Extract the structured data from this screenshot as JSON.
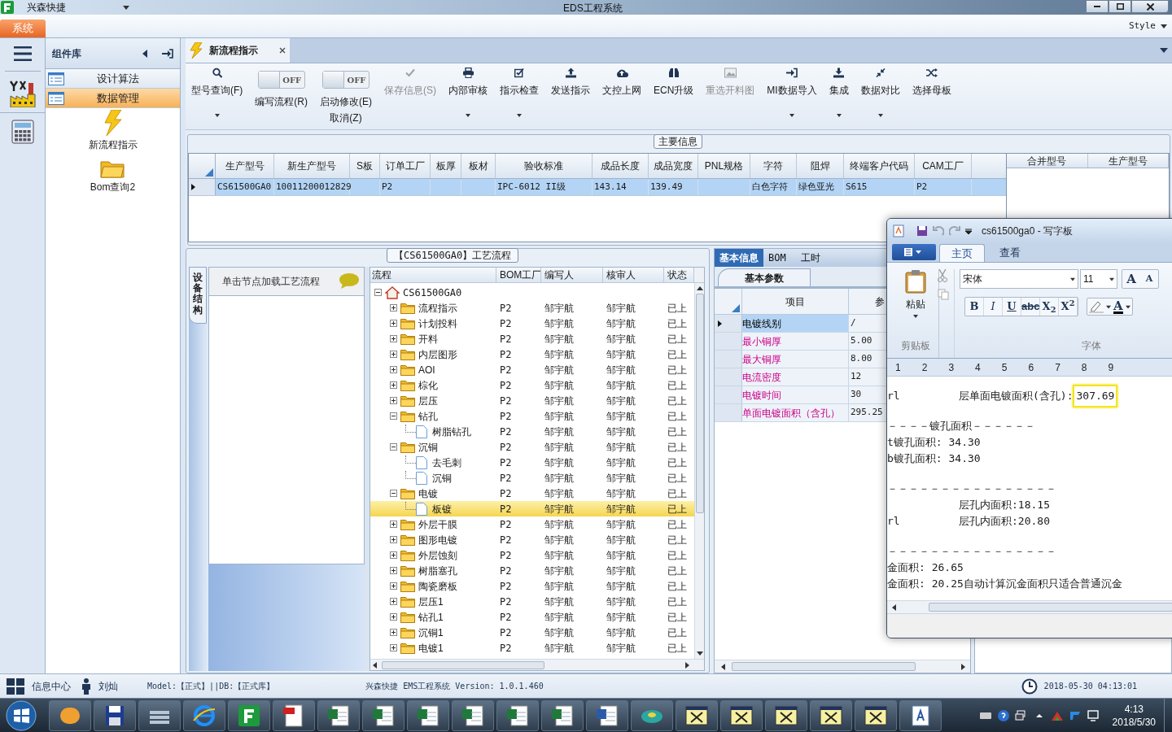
{
  "title_bar": {
    "app_name": "兴森快捷",
    "title": "EDS工程系统"
  },
  "menu_bar": {
    "tabs": [
      {
        "label": "系统",
        "selected": true
      }
    ],
    "style_label": "Style"
  },
  "sidebar": {
    "title": "组件库",
    "items": [
      {
        "label": "设计算法",
        "selected": false
      },
      {
        "label": "数据管理",
        "selected": true
      }
    ],
    "shortcuts": [
      {
        "label": "新流程指示",
        "kind": "lightning"
      },
      {
        "label": "Bom查询2",
        "kind": "folder"
      }
    ]
  },
  "document_tabs": [
    {
      "label": "新流程指示",
      "selected": true
    }
  ],
  "toolbar": [
    {
      "kind": "button",
      "label": "型号查询(F)",
      "dropdown": true,
      "disabled": false
    },
    {
      "kind": "toggle",
      "label": "编写流程(R)",
      "state_text": "OFF",
      "on": false
    },
    {
      "kind": "toggle",
      "label": "启动修改(E)",
      "sublabel": "取消(Z)",
      "state_text": "OFF",
      "on": false
    },
    {
      "kind": "button",
      "label": "保存信息(S)",
      "dropdown": false,
      "disabled": true
    },
    {
      "kind": "button",
      "label": "内部审核",
      "dropdown": true,
      "disabled": false
    },
    {
      "kind": "button",
      "label": "指示检查",
      "dropdown": true,
      "disabled": false
    },
    {
      "kind": "button",
      "label": "发送指示",
      "dropdown": false,
      "disabled": false
    },
    {
      "kind": "button",
      "label": "文控上网",
      "dropdown": false,
      "disabled": false
    },
    {
      "kind": "button",
      "label": "ECN升级",
      "dropdown": false,
      "disabled": false
    },
    {
      "kind": "button",
      "label": "重选开料图",
      "dropdown": false,
      "disabled": true
    },
    {
      "kind": "button",
      "label": "MI数据导入",
      "dropdown": true,
      "disabled": false
    },
    {
      "kind": "button",
      "label": "集成",
      "dropdown": true,
      "disabled": false
    },
    {
      "kind": "button",
      "label": "数据对比",
      "dropdown": true,
      "disabled": false
    },
    {
      "kind": "button",
      "label": "选择母板",
      "dropdown": false,
      "disabled": false
    }
  ],
  "main_info": {
    "title": "主要信息",
    "row_selected": true,
    "columns": [
      {
        "header": "生产型号",
        "cell": "CS61500GA0"
      },
      {
        "header": "新生产型号",
        "cell": "10011200012829"
      },
      {
        "header": "S板"
      },
      {
        "header": "订单工厂",
        "cell": "P2"
      },
      {
        "header": "板厚"
      },
      {
        "header": "板材"
      },
      {
        "header": "验收标准",
        "cell": "IPC-6012 II级"
      },
      {
        "header": "成品长度",
        "cell": "143.14"
      },
      {
        "header": "成品宽度",
        "cell": "139.49"
      },
      {
        "header": "PNL规格"
      },
      {
        "header": "字符",
        "cell": "白色字符"
      },
      {
        "header": "阻焊",
        "cell": "绿色亚光"
      },
      {
        "header": "终端客户代码",
        "cell": "S615"
      },
      {
        "header": "CAM工厂",
        "cell": "P2"
      }
    ],
    "side_columns": [
      "合并型号",
      "生产型号"
    ]
  },
  "process_flow": {
    "title": "【CS61500GA0】工艺流程",
    "side_tab": "设备结构",
    "hint": "单击节点加载工艺流程",
    "columns": [
      "流程",
      "BOM工厂",
      "编写人",
      "核审人",
      "状态"
    ],
    "tree": [
      {
        "label": "CS61500GA0",
        "kind": "root",
        "expanded": true,
        "selected": false,
        "children": [
          {
            "label": "流程指示",
            "kind": "folder",
            "expanded": false,
            "selected": false,
            "bom_factory": "P2",
            "author": "邹宇航",
            "reviewer": "邹宇航",
            "status": "已上"
          },
          {
            "label": "计划投料",
            "kind": "folder",
            "expanded": false,
            "selected": false,
            "bom_factory": "P2",
            "author": "邹宇航",
            "reviewer": "邹宇航",
            "status": "已上"
          },
          {
            "label": "开料",
            "kind": "folder",
            "expanded": false,
            "selected": false,
            "bom_factory": "P2",
            "author": "邹宇航",
            "reviewer": "邹宇航",
            "status": "已上"
          },
          {
            "label": "内层图形",
            "kind": "folder",
            "expanded": false,
            "selected": false,
            "bom_factory": "P2",
            "author": "邹宇航",
            "reviewer": "邹宇航",
            "status": "已上"
          },
          {
            "label": "AOI",
            "kind": "folder",
            "expanded": false,
            "selected": false,
            "bom_factory": "P2",
            "author": "邹宇航",
            "reviewer": "邹宇航",
            "status": "已上"
          },
          {
            "label": "棕化",
            "kind": "folder",
            "expanded": false,
            "selected": false,
            "bom_factory": "P2",
            "author": "邹宇航",
            "reviewer": "邹宇航",
            "status": "已上"
          },
          {
            "label": "层压",
            "kind": "folder",
            "expanded": false,
            "selected": false,
            "bom_factory": "P2",
            "author": "邹宇航",
            "reviewer": "邹宇航",
            "status": "已上"
          },
          {
            "label": "钻孔",
            "kind": "folder",
            "expanded": true,
            "selected": false,
            "bom_factory": "P2",
            "author": "邹宇航",
            "reviewer": "邹宇航",
            "status": "已上",
            "children": [
              {
                "label": "树脂钻孔",
                "kind": "step",
                "selected": false,
                "bom_factory": "P2",
                "author": "邹宇航",
                "reviewer": "邹宇航",
                "status": "已上"
              }
            ]
          },
          {
            "label": "沉铜",
            "kind": "folder",
            "expanded": true,
            "selected": false,
            "bom_factory": "P2",
            "author": "邹宇航",
            "reviewer": "邹宇航",
            "status": "已上",
            "children": [
              {
                "label": "去毛刺",
                "kind": "step",
                "selected": false,
                "bom_factory": "P2",
                "author": "邹宇航",
                "reviewer": "邹宇航",
                "status": "已上"
              },
              {
                "label": "沉铜",
                "kind": "step",
                "selected": false,
                "bom_factory": "P2",
                "author": "邹宇航",
                "reviewer": "邹宇航",
                "status": "已上"
              }
            ]
          },
          {
            "label": "电镀",
            "kind": "folder",
            "expanded": true,
            "selected": false,
            "bom_factory": "P2",
            "author": "邹宇航",
            "reviewer": "邹宇航",
            "status": "已上",
            "children": [
              {
                "label": "板镀",
                "kind": "step",
                "selected": true,
                "bom_factory": "P2",
                "author": "邹宇航",
                "reviewer": "邹宇航",
                "status": "已上"
              }
            ]
          },
          {
            "label": "外层干膜",
            "kind": "folder",
            "expanded": false,
            "selected": false,
            "bom_factory": "P2",
            "author": "邹宇航",
            "reviewer": "邹宇航",
            "status": "已上"
          },
          {
            "label": "图形电镀",
            "kind": "folder",
            "expanded": false,
            "selected": false,
            "bom_factory": "P2",
            "author": "邹宇航",
            "reviewer": "邹宇航",
            "status": "已上"
          },
          {
            "label": "外层蚀刻",
            "kind": "folder",
            "expanded": false,
            "selected": false,
            "bom_factory": "P2",
            "author": "邹宇航",
            "reviewer": "邹宇航",
            "status": "已上"
          },
          {
            "label": "树脂塞孔",
            "kind": "folder",
            "expanded": false,
            "selected": false,
            "bom_factory": "P2",
            "author": "邹宇航",
            "reviewer": "邹宇航",
            "status": "已上"
          },
          {
            "label": "陶瓷磨板",
            "kind": "folder",
            "expanded": false,
            "selected": false,
            "bom_factory": "P2",
            "author": "邹宇航",
            "reviewer": "邹宇航",
            "status": "已上"
          },
          {
            "label": "层压1",
            "kind": "folder",
            "expanded": false,
            "selected": false,
            "bom_factory": "P2",
            "author": "邹宇航",
            "reviewer": "邹宇航",
            "status": "已上"
          },
          {
            "label": "钻孔1",
            "kind": "folder",
            "expanded": false,
            "selected": false,
            "bom_factory": "P2",
            "author": "邹宇航",
            "reviewer": "邹宇航",
            "status": "已上"
          },
          {
            "label": "沉铜1",
            "kind": "folder",
            "expanded": false,
            "selected": false,
            "bom_factory": "P2",
            "author": "邹宇航",
            "reviewer": "邹宇航",
            "status": "已上"
          },
          {
            "label": "电镀1",
            "kind": "folder",
            "expanded": false,
            "selected": false,
            "bom_factory": "P2",
            "author": "邹宇航",
            "reviewer": "邹宇航",
            "status": "已上"
          }
        ]
      }
    ]
  },
  "detail_panel": {
    "tabs": [
      {
        "label": "基本信息",
        "selected": true
      },
      {
        "label": "BOM",
        "selected": false
      },
      {
        "label": "工时",
        "selected": false
      }
    ],
    "sub_tab": "基本参数",
    "columns": [
      "项目",
      "参"
    ],
    "rows": [
      {
        "item": "电镀线别",
        "value": "/",
        "selected": true,
        "emphasized": false
      },
      {
        "item": "最小铜厚",
        "value": "5.00",
        "selected": false,
        "emphasized": true
      },
      {
        "item": "最大铜厚",
        "value": "8.00",
        "selected": false,
        "emphasized": true
      },
      {
        "item": "电流密度",
        "value": "12",
        "selected": false,
        "emphasized": true
      },
      {
        "item": "电镀时间",
        "value": "30",
        "selected": false,
        "emphasized": true
      },
      {
        "item": "单面电镀面积（含孔）",
        "value": "295.25",
        "selected": false,
        "emphasized": true
      }
    ]
  },
  "wordpad": {
    "title": "cs61500ga0 - 写字板",
    "tabs": [
      {
        "label": "主页",
        "selected": true
      },
      {
        "label": "查看",
        "selected": false
      }
    ],
    "paste_label": "粘贴",
    "clipboard_group": "剪贴板",
    "font_name": "宋体",
    "font_size": "11",
    "grow_buttons": [
      "A",
      "A"
    ],
    "format_buttons": [
      "B",
      "I",
      "U",
      "abc",
      "X$_{2}$",
      "X$^{2}$"
    ],
    "font_color_button": "A",
    "font_group": "字体",
    "ruler": [
      "1",
      "2",
      "3",
      "4",
      "5",
      "6",
      "7",
      "8",
      "9"
    ],
    "lines": [
      {
        "kind": "tabbed",
        "prefix": "rl",
        "text": "层单面电镀面积(含孔):",
        "boxed": "307.69"
      },
      {
        "kind": "rule",
        "text": "－－－－镀孔面积－－－－－－"
      },
      {
        "kind": "plain",
        "text": "t镀孔面积: 34.30"
      },
      {
        "kind": "plain",
        "text": "b镀孔面积: 34.30"
      },
      {
        "kind": "rule",
        "text": "－－－－－－－－－－－－－－－－"
      },
      {
        "kind": "tabbed",
        "text": "层孔内面积:18.15"
      },
      {
        "kind": "tabbed",
        "prefix": "rl",
        "text": "层孔内面积:20.80"
      },
      {
        "kind": "rule",
        "text": "－－－－－－－－－－－－－－－－"
      },
      {
        "kind": "plain",
        "text": "金面积: 26.65"
      },
      {
        "kind": "plain",
        "text": "金面积: 20.25自动计算沉金面积只适合普通沉金"
      }
    ]
  },
  "status_bar": {
    "info_center": "信息中心",
    "user": "刘灿",
    "model": "Model:【正式】||DB:【正式库】",
    "version": "兴森快捷 EMS工程系统 Version: 1.0.1.460",
    "datetime": "2018-05-30 04:13:01"
  },
  "taskbar": {
    "time": "4:13",
    "date": "2018/5/30"
  }
}
